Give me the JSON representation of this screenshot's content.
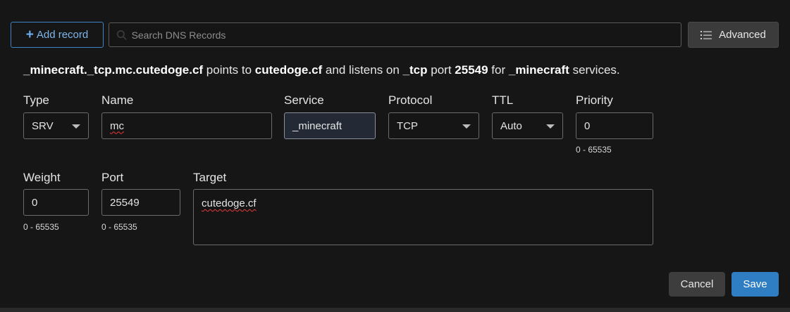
{
  "toolbar": {
    "add_record_label": "Add record",
    "search_placeholder": "Search DNS Records",
    "advanced_label": "Advanced"
  },
  "summary": {
    "record_name": "_minecraft._tcp.mc.cutedoge.cf",
    "text_points_to": " points to ",
    "target": "cutedoge.cf",
    "text_listens_on": " and listens on ",
    "protocol": "_tcp",
    "text_port": " port ",
    "port": "25549",
    "text_for": " for ",
    "service": "_minecraft",
    "text_services": " services."
  },
  "form": {
    "type": {
      "label": "Type",
      "value": "SRV"
    },
    "name": {
      "label": "Name",
      "value": "mc"
    },
    "service": {
      "label": "Service",
      "value": "_minecraft"
    },
    "protocol": {
      "label": "Protocol",
      "value": "TCP"
    },
    "ttl": {
      "label": "TTL",
      "value": "Auto"
    },
    "priority": {
      "label": "Priority",
      "value": "0",
      "hint": "0 - 65535"
    },
    "weight": {
      "label": "Weight",
      "value": "0",
      "hint": "0 - 65535"
    },
    "port": {
      "label": "Port",
      "value": "25549",
      "hint": "0 - 65535"
    },
    "target": {
      "label": "Target",
      "value": "cutedoge.cf"
    }
  },
  "actions": {
    "cancel_label": "Cancel",
    "save_label": "Save"
  },
  "colors": {
    "background": "#161616",
    "accent": "#2f7dc2",
    "add_border": "#3c83c7"
  }
}
